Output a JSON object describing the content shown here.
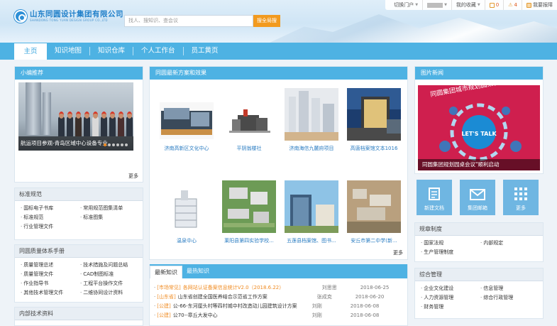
{
  "header": {
    "logo_text": "山东同圆设计集团有限公司",
    "logo_sub": "SHANDONG TONG YUAN DESIGN GROUP CO.,LTD",
    "search_placeholder": "找人、搜知识、查会议",
    "search_button": "搜全局搜",
    "topbar": {
      "portal": "切换门户",
      "favorites": "我的收藏",
      "count_a": "0",
      "count_b": "4",
      "report": "我要报障"
    }
  },
  "nav": {
    "items": [
      "主页",
      "知识地图",
      "知识仓库",
      "个人工作台",
      "员工黄页"
    ],
    "active_index": 0
  },
  "left": {
    "recommend": {
      "title": "小编推荐",
      "caption": "航运项目参观-青岛区域中心设备专业",
      "more": "更多",
      "slide_count": 6,
      "active_slide": 0
    },
    "standards": {
      "title": "标准规范",
      "items": [
        "国标电子书库",
        "常用规范图集清单",
        "标准规范",
        "标准图集",
        "行业管理文件"
      ]
    },
    "manual": {
      "title": "同圆质量体系手册",
      "items": [
        "质量管理总述",
        "技术措施及问题总结",
        "质量管理文件",
        "CAD制图标准",
        "作业指导书",
        "工程平台操作文件",
        "其他技术管理文件",
        "二维协同设计资料"
      ]
    },
    "internal": {
      "title": "内部技术资料"
    }
  },
  "center": {
    "latest": {
      "title": "同圆最新方案和效果",
      "more": "更多",
      "items": [
        "济南高新区文化中心",
        "平阴翁楼社",
        "济南海信九麓府项目",
        "高唐档案馆文本1016",
        "温泉中心",
        "莱阳县第四实验学校...",
        "五莲县档案馆、图书...",
        "安丘市第二中学(新..."
      ]
    },
    "news": {
      "tabs": [
        "最新知识",
        "最热知识"
      ],
      "active_tab": 0,
      "rows": [
        {
          "tag": "[市场常见]",
          "text": "各网站认证备案信息统计V2.0（2018.6.22）",
          "author": "刘思思",
          "date": "2018-06-25",
          "highlight": true
        },
        {
          "tag": "[山东省]",
          "text": "山东省创建全国医养结合示范省工作方案",
          "author": "张成克",
          "date": "2018-06-20",
          "highlight": false
        },
        {
          "tag": "[公建]",
          "text": "公-66-东河厘头村等四村城中村改造动儿园建筑设计方案",
          "author": "刘刚",
          "date": "2018-06-08",
          "highlight": false
        },
        {
          "tag": "[公建]",
          "text": "公70--章丘大发中心",
          "author": "刘刚",
          "date": "2018-06-08",
          "highlight": false
        }
      ]
    }
  },
  "right": {
    "photo_news": {
      "title": "图片新闻",
      "caption": "同圆集团规划园桌会议\"顺利启动",
      "banner_line": "同圆集团城市规划圆桌会议",
      "badge": "LET'S TALK"
    },
    "tiles": [
      {
        "label": "新建文档",
        "icon": "document-icon"
      },
      {
        "label": "集团邮箱",
        "icon": "mail-icon"
      },
      {
        "label": "更多",
        "icon": "grid-icon"
      }
    ],
    "rules": {
      "title": "规章制度",
      "items": [
        "国家法规",
        "内部规定",
        "生产管理制度"
      ]
    },
    "admin": {
      "title": "综合管理",
      "items": [
        "企业文化建设",
        "信息管理",
        "人力资源管理",
        "综合行政管理",
        "财务管理"
      ]
    }
  },
  "colors": {
    "nav": "#4eb2e3",
    "accent_orange": "#f29a1f",
    "link_blue": "#2a7cc2",
    "banner_red": "#d2204f"
  }
}
